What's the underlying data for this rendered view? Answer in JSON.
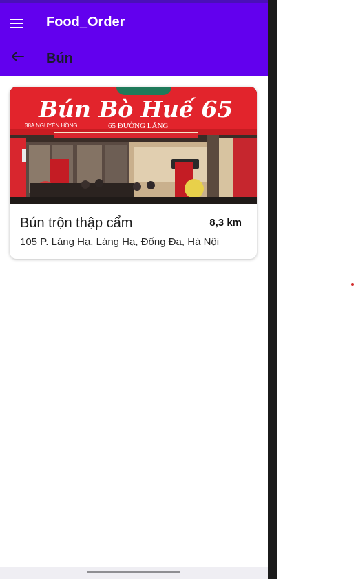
{
  "app": {
    "title": "Food_Order",
    "colors": {
      "primary": "#6200ee",
      "status_bar": "#4a0fb8",
      "on_primary": "#ffffff"
    }
  },
  "toolbar": {
    "menu_icon": "hamburger-menu-icon",
    "back_icon": "arrow-left-icon",
    "category_title": "Bún"
  },
  "restaurants": [
    {
      "sign_text": "Bún Bò Huế 65",
      "sign_subtext": "65 ĐƯỜNG LÁNG",
      "sign_side": "38A NGUYÊN HỒNG",
      "name": "Bún trộn thập cẩm",
      "distance": "8,3 km",
      "address": "105 P. Láng Hạ, Láng Hạ, Đống Đa, Hà Nội"
    }
  ]
}
